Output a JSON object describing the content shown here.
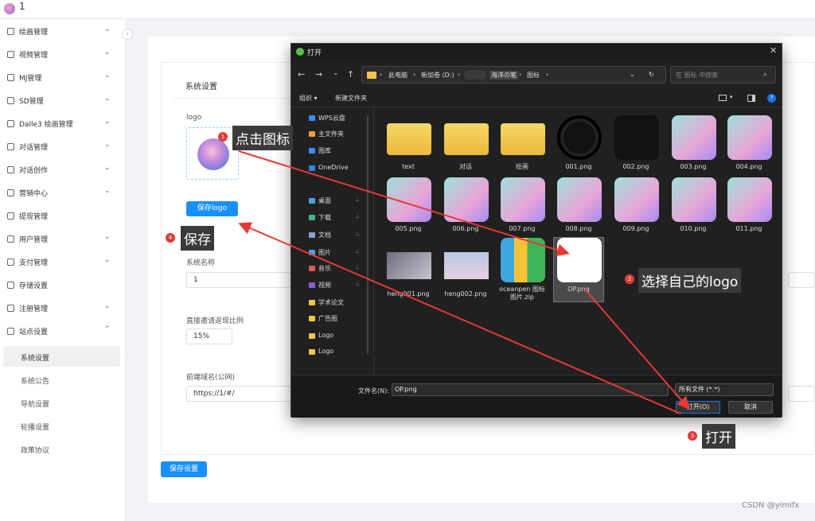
{
  "topbar": {
    "title": "1"
  },
  "sidebar": {
    "items": [
      {
        "label": "绘画管理",
        "chevron": "⌄"
      },
      {
        "label": "视频管理",
        "chevron": "⌄"
      },
      {
        "label": "MJ管理",
        "chevron": "⌄"
      },
      {
        "label": "SD管理",
        "chevron": "⌄"
      },
      {
        "label": "Dalle3 绘画管理",
        "chevron": "⌄"
      },
      {
        "label": "对话管理",
        "chevron": "⌄"
      },
      {
        "label": "对话创作",
        "chevron": "⌄"
      },
      {
        "label": "营销中心",
        "chevron": "⌄"
      },
      {
        "label": "提现管理",
        "chevron": ""
      },
      {
        "label": "用户管理",
        "chevron": "⌄"
      },
      {
        "label": "支付管理",
        "chevron": "⌄"
      },
      {
        "label": "存储设置",
        "chevron": ""
      },
      {
        "label": "注册管理",
        "chevron": "⌄"
      },
      {
        "label": "站点设置",
        "chevron": "⌃"
      }
    ],
    "sub_items": [
      {
        "label": "系统设置",
        "active": true
      },
      {
        "label": "系统公告"
      },
      {
        "label": "导航设置"
      },
      {
        "label": "轮播设置"
      },
      {
        "label": "政策协议"
      }
    ]
  },
  "main": {
    "section_title": "系统设置",
    "logo_label": "logo",
    "save_logo_button": "保存logo",
    "system_name_label": "系统名称",
    "system_name_value": "1",
    "invite_label": "直接邀请返现比例",
    "invite_value": "15%",
    "domain_label": "前端域名(公网)",
    "domain_value": "https://1/#/",
    "save_settings_button": "保存设置"
  },
  "dialog": {
    "title": "打开",
    "close": "✕",
    "path": [
      "此电脑",
      "新加卷 (D:)",
      "海洋の笔",
      "图标"
    ],
    "search_placeholder": "在 图标 中搜索",
    "organize_label": "组织 ▾",
    "new_folder_label": "新建文件夹",
    "nav": [
      {
        "label": "WPS云盘",
        "pin": false
      },
      {
        "label": "主文件夹",
        "pin": false
      },
      {
        "label": "图库",
        "pin": false
      },
      {
        "label": "OneDrive",
        "pin": false
      },
      {
        "label": "桌面",
        "pin": true
      },
      {
        "label": "下载",
        "pin": true
      },
      {
        "label": "文档",
        "pin": true
      },
      {
        "label": "图片",
        "pin": true
      },
      {
        "label": "音乐",
        "pin": true
      },
      {
        "label": "视频",
        "pin": true
      },
      {
        "label": "学术论文",
        "pin": false
      },
      {
        "label": "广告图",
        "pin": false
      },
      {
        "label": "Logo",
        "pin": false
      },
      {
        "label": "Logo",
        "pin": false
      }
    ],
    "files": [
      {
        "name": "text",
        "kind": "folder"
      },
      {
        "name": "对话",
        "kind": "folder"
      },
      {
        "name": "绘画",
        "kind": "folder"
      },
      {
        "name": "001.png",
        "kind": "palette"
      },
      {
        "name": "002.png",
        "kind": "grid"
      },
      {
        "name": "003.png",
        "kind": "avatar"
      },
      {
        "name": "004.png",
        "kind": "avatar"
      },
      {
        "name": "005.png",
        "kind": "avatar"
      },
      {
        "name": "006.png",
        "kind": "avatar"
      },
      {
        "name": "007.png",
        "kind": "avatar"
      },
      {
        "name": "008.png",
        "kind": "avatar"
      },
      {
        "name": "009.png",
        "kind": "avatar"
      },
      {
        "name": "010.png",
        "kind": "avatar"
      },
      {
        "name": "011.png",
        "kind": "avatar"
      },
      {
        "name": "heng001.png",
        "kind": "photo"
      },
      {
        "name": "heng002.png",
        "kind": "strip"
      },
      {
        "name": "oceanpen 图标图片.zip",
        "kind": "zip"
      },
      {
        "name": "OP.png",
        "kind": "op",
        "selected": true
      }
    ],
    "filename_label": "文件名(N):",
    "filename_value": "OP.png",
    "filetype_value": "所有文件 (*.*)",
    "open_button": "打开(O)",
    "cancel_button": "取消"
  },
  "annotations": [
    {
      "num": "1",
      "text": "点击图标"
    },
    {
      "num": "2",
      "text": "选择自己的logo"
    },
    {
      "num": "3",
      "text": "打开"
    },
    {
      "num": "4",
      "text": "保存"
    }
  ],
  "colors": {
    "primary": "#1890ff",
    "annotation": "#e53935",
    "dialog_bg": "#202020"
  },
  "watermark": "CSDN @yimifx"
}
